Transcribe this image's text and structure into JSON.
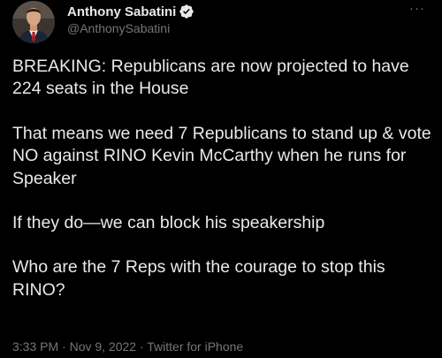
{
  "author": {
    "display_name": "Anthony Sabatini",
    "handle": "@AnthonySabatini",
    "avatar_icon": "profile-photo",
    "verified_icon": "verified-badge-icon",
    "verified_color": "#1d9bf0"
  },
  "menu": {
    "more_label": "···",
    "more_icon": "more-options-icon"
  },
  "tweet": {
    "paragraphs": [
      "BREAKING: Republicans are now projected to have 224 seats in the House",
      "That means we need 7 Republicans to stand up & vote NO against RINO Kevin McCarthy when he runs for Speaker",
      "If they do—we can block his speakership",
      "Who are the 7 Reps with the courage to stop this RINO?"
    ]
  },
  "meta": {
    "timestamp_line": "3:33 PM · Nov 9, 2022 · Twitter for iPhone"
  },
  "colors": {
    "background": "#000000",
    "text": "#e7e9ea",
    "secondary_text": "#71767b"
  }
}
